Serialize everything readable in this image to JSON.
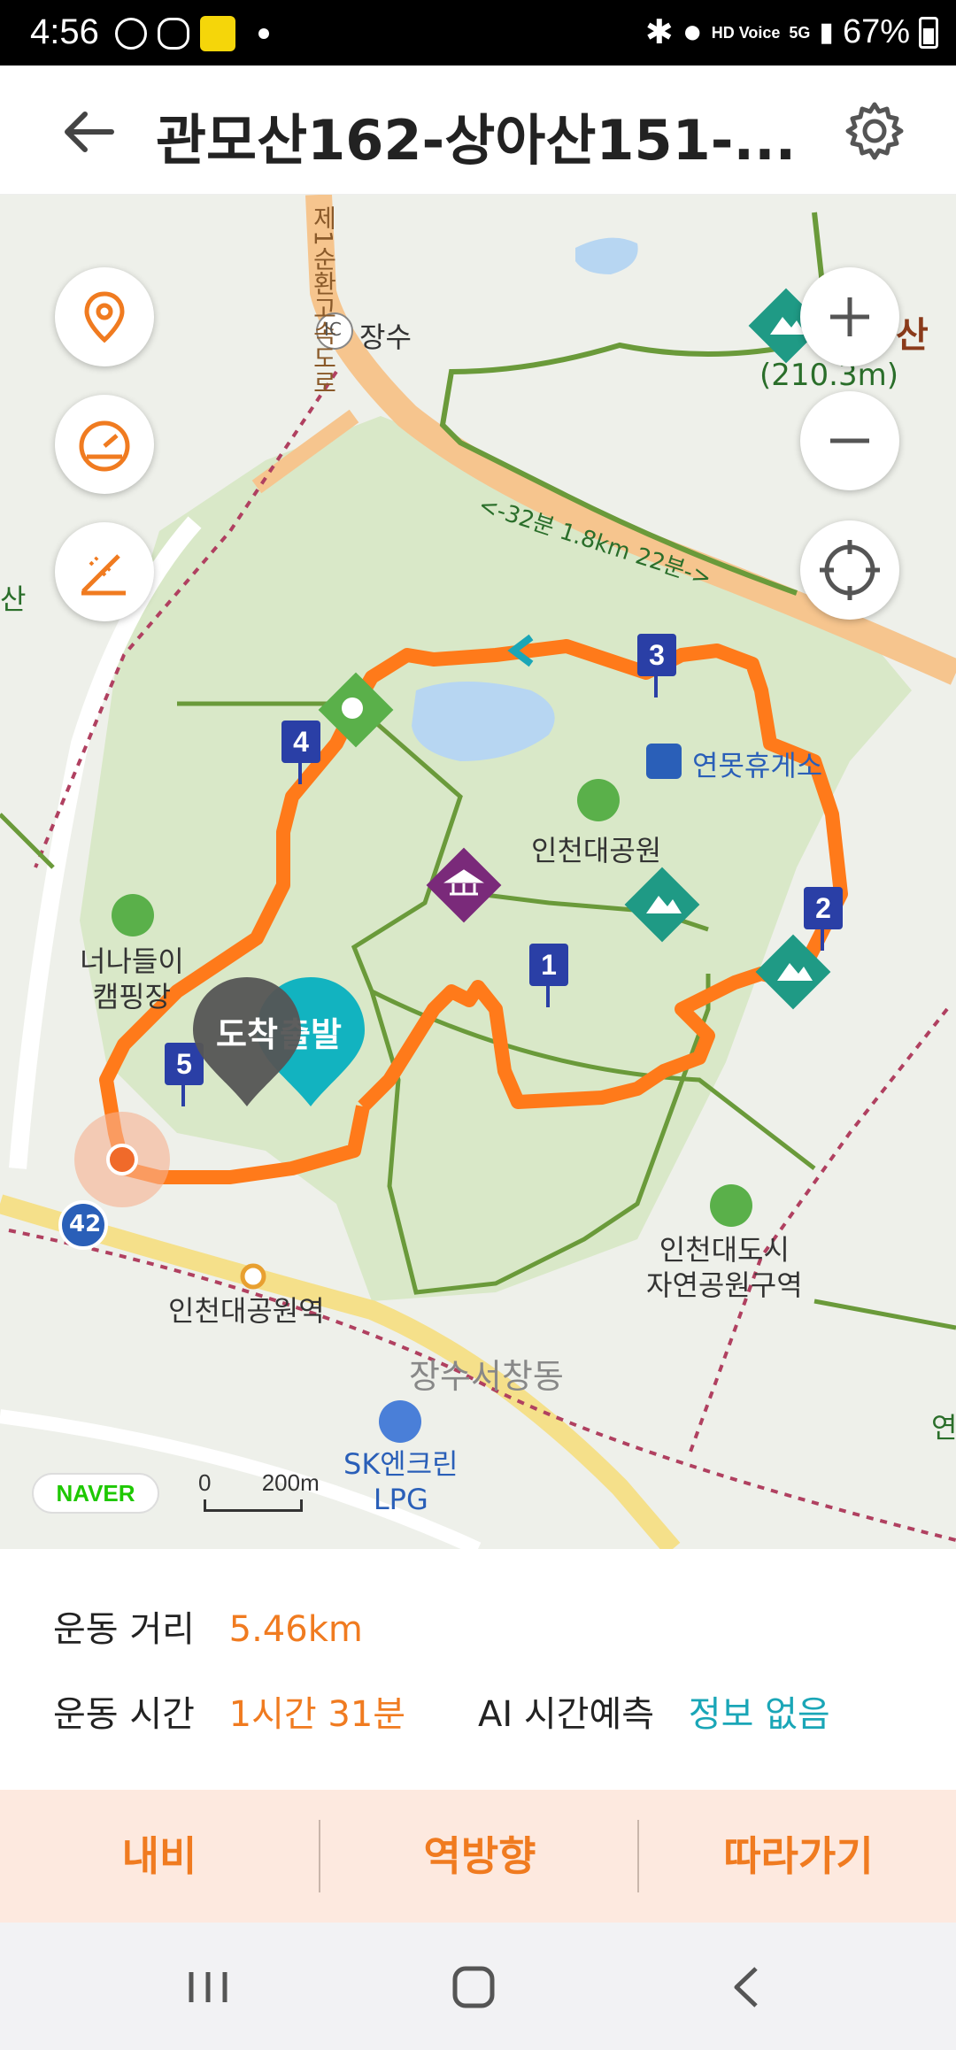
{
  "status_bar": {
    "time": "4:56",
    "signal_labels": [
      "HD Voice",
      "5G"
    ],
    "battery": "67%"
  },
  "header": {
    "title": "관모산162-상아산151-..."
  },
  "map": {
    "labels": {
      "expressway": "제1순환고속도로",
      "ic_badge": "IC",
      "ic_name": "장수",
      "peak_elev": "(210.3m)",
      "peak_name_partial": "산",
      "route_time": "<-32분 1.8km 22분->",
      "left_edge": "산",
      "rest_area": "연못휴게소",
      "park": "인천대공원",
      "camping": "너나들이\n캠핑장",
      "station": "인천대공원역",
      "nature_park": "인천대도시\n자연공원구역",
      "district": "장수서창동",
      "gas_station": "SK엔크린\nLPG",
      "right_edge": "연",
      "road_badge": "42"
    },
    "pins": {
      "arrival": "도착",
      "departure": "출발"
    },
    "markers": [
      "1",
      "2",
      "3",
      "4",
      "5"
    ],
    "naver_logo": "NAVER",
    "scale_zero": "0",
    "scale_label": "200m"
  },
  "info": {
    "distance_label": "운동 거리",
    "distance_value": "5.46km",
    "time_label": "운동 시간",
    "time_value": "1시간 31분",
    "ai_label": "AI 시간예측",
    "ai_value": "정보 없음"
  },
  "actions": {
    "navi": "내비",
    "reverse": "역방향",
    "follow": "따라가기"
  },
  "colors": {
    "accent": "#f07b20",
    "teal": "#1aa6b7",
    "route": "#ff7a1a",
    "marker": "#2a3fa6",
    "park_green": "#d9e8c8",
    "trail": "#6a9a3a"
  },
  "icons": {
    "back": "arrow-left-icon",
    "settings": "gear-icon",
    "location": "location-pin-icon",
    "speed": "speedometer-icon",
    "altitude": "elevation-icon",
    "zoom_in": "plus-icon",
    "zoom_out": "minus-icon",
    "current_location": "crosshair-icon"
  }
}
